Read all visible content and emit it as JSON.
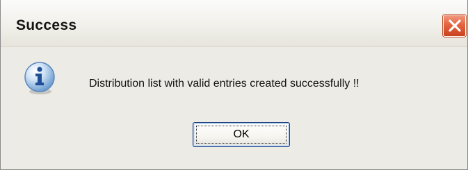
{
  "window": {
    "title": "Success",
    "close_icon": "close-icon"
  },
  "message": {
    "icon": "info-icon",
    "text": "Distribution list with valid entries created successfully !!"
  },
  "buttons": {
    "ok_label": "OK"
  },
  "colors": {
    "dialog_background": "#ece9d8",
    "close_button": "#e4643f",
    "button_border": "#1d3f7a"
  }
}
